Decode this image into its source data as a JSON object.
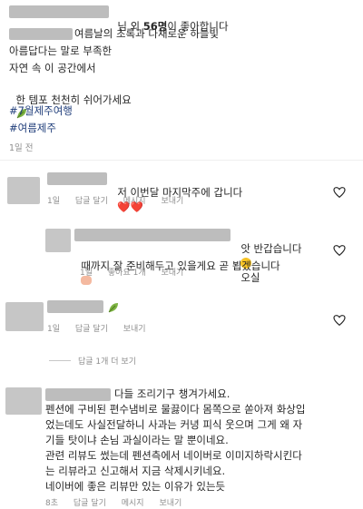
{
  "post": {
    "likes_prefix": "님 외 ",
    "likes_count": "56명",
    "likes_suffix": "이 좋아합니다",
    "caption_line1": "여름날의 초록과 다채로운 하늘빛",
    "caption_line2": "아름답다는 말로 부족한",
    "caption_line3": "자연 속 이 공간에서",
    "caption_line4": "한 템포 천천히 쉬어가세요",
    "hashtag1": "#7월제주여행",
    "hashtag2": "#여름제주",
    "time": "1일 전"
  },
  "comments": [
    {
      "text": "저 이번달 마지막주에 갑니다",
      "emoji": "❤️❤️",
      "time": "1일",
      "like": "",
      "reply": "답글 달기",
      "message": "메시지",
      "send": "보내기"
    },
    {
      "text_line1": "앗 반갑습니다",
      "text_line1b": "오실",
      "text_line2": "때까지 잘 준비해두고 있을게요 곧 뵙겠습니다",
      "time": "1일",
      "like": "좋아요 1개",
      "send": "보내기"
    },
    {
      "time": "1일",
      "reply": "답글 달기",
      "send": "보내기",
      "more_replies": "답글 1개 더 보기"
    },
    {
      "line1": "다들 조리기구 챙겨가세요.",
      "line2": "펜션에 구비된 편수냄비로 물끓이다 몸쪽으로 쏟아져 화상입",
      "line3": "었는데도 사실전달하니 사과는 커녕 피식 웃으며 그게 왜 자",
      "line4": "기들 탓이냐 손님 과실이라는 말 뿐이네요.",
      "line5": "관련 리뷰도 썼는데 펜션측에서 네이버로 이미지하락시킨다",
      "line6": "는 리뷰라고 신고해서 지금 삭제시키네요.",
      "line7": "네이버에 좋은 리뷰만 있는 이유가 있는듯",
      "time": "8초",
      "reply": "답글 달기",
      "message": "메시지",
      "send": "보내기"
    }
  ],
  "colors": {
    "text": "#262626",
    "meta": "#8e8e8e",
    "hashtag": "#1f3d7a",
    "heart": "#e53935"
  },
  "icons": [
    "heart-outline-icon",
    "leaf-icon",
    "heart-eyes-emoji",
    "praying-hands-emoji"
  ]
}
